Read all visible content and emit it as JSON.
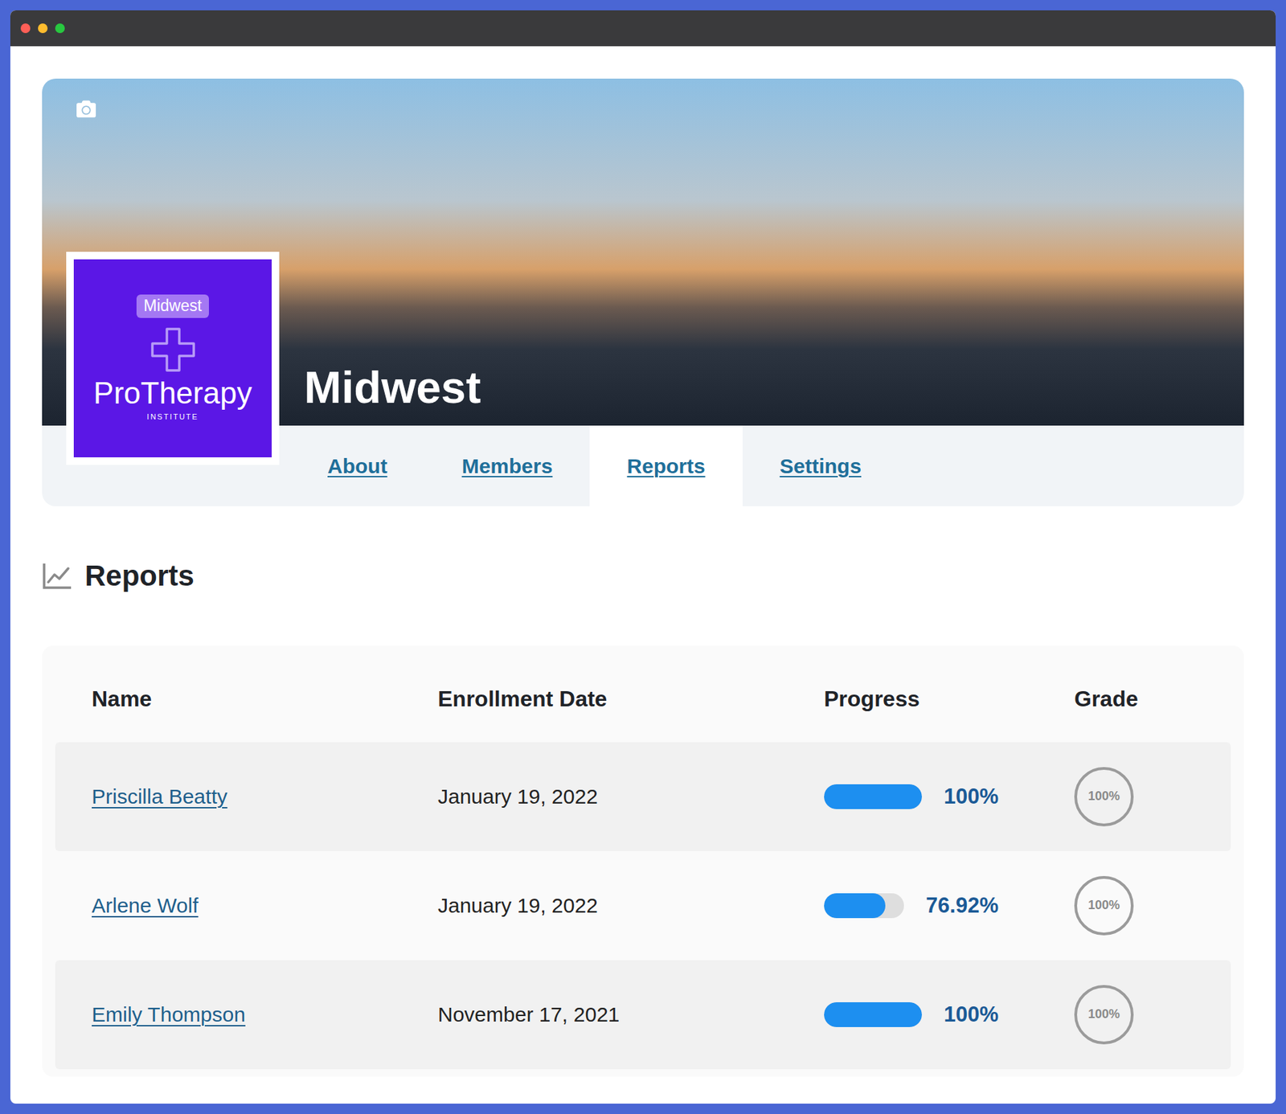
{
  "header": {
    "title": "Midwest",
    "logo": {
      "badge": "Midwest",
      "name": "ProTherapy",
      "subtitle": "INSTITUTE"
    }
  },
  "tabs": [
    {
      "label": "About",
      "selected": false
    },
    {
      "label": "Members",
      "selected": false
    },
    {
      "label": "Reports",
      "selected": true
    },
    {
      "label": "Settings",
      "selected": false
    }
  ],
  "section": {
    "title": "Reports"
  },
  "table": {
    "columns": [
      "Name",
      "Enrollment Date",
      "Progress",
      "Grade"
    ],
    "rows": [
      {
        "name": "Priscilla Beatty",
        "enrollment_date": "January 19, 2022",
        "progress": {
          "level": 1,
          "reading": "100%"
        },
        "grade": "100%"
      },
      {
        "name": "Arlene Wolf",
        "enrollment_date": "January 19, 2022",
        "progress": {
          "level": 0.7692,
          "reading": "76.92%"
        },
        "grade": "100%"
      },
      {
        "name": "Emily Thompson",
        "enrollment_date": "November 17, 2021",
        "progress": {
          "level": 1,
          "reading": "100%"
        },
        "grade": "100%"
      }
    ]
  }
}
